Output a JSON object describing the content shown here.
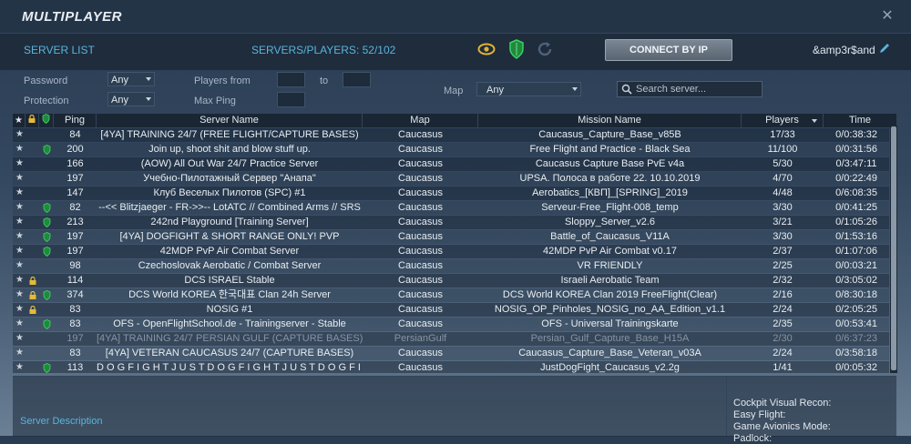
{
  "window": {
    "title": "MULTIPLAYER",
    "close_glyph": "✕"
  },
  "topbar": {
    "server_list_label": "SERVER LIST",
    "players_label": "SERVERS/PLAYERS: 52/102",
    "connect_label": "CONNECT BY IP",
    "nickname": "&amp3r$and",
    "icons": [
      "eye-icon",
      "shield-icon",
      "refresh-icon",
      "pencil-icon"
    ]
  },
  "filters": {
    "password_label": "Password",
    "password_value": "Any",
    "protection_label": "Protection",
    "protection_value": "Any",
    "players_from_label": "Players from",
    "to_label": "to",
    "max_ping_label": "Max Ping",
    "map_label": "Map",
    "map_value": "Any",
    "search_placeholder": "Search server..."
  },
  "table": {
    "headers": {
      "ping": "Ping",
      "name": "Server Name",
      "map": "Map",
      "mission": "Mission Name",
      "players": "Players",
      "time": "Time"
    },
    "rows": [
      {
        "lock": false,
        "shield": false,
        "ping": "84",
        "name": "[4YA] TRAINING 24/7 (FREE FLIGHT/CAPTURE BASES)",
        "map": "Caucasus",
        "mission": "Caucasus_Capture_Base_v85B",
        "players": "17/33",
        "time": "0/0:38:32",
        "dim": false
      },
      {
        "lock": false,
        "shield": true,
        "ping": "200",
        "name": "Join up, shoot shit and blow stuff up.",
        "map": "Caucasus",
        "mission": "Free Flight and Practice - Black Sea",
        "players": "11/100",
        "time": "0/0:31:56",
        "dim": false
      },
      {
        "lock": false,
        "shield": false,
        "ping": "166",
        "name": "(AOW) All Out War 24/7 Practice Server",
        "map": "Caucasus",
        "mission": "Caucasus Capture Base PvE v4a",
        "players": "5/30",
        "time": "0/3:47:11",
        "dim": false
      },
      {
        "lock": false,
        "shield": false,
        "ping": "197",
        "name": "Учебно-Пилотажный Сервер \"Анапа\"",
        "map": "Caucasus",
        "mission": "UPSA. Полоса в работе 22.  10.10.2019",
        "players": "4/70",
        "time": "0/0:22:49",
        "dim": false
      },
      {
        "lock": false,
        "shield": false,
        "ping": "147",
        "name": "Клуб Веселых Пилотов (SPC) #1",
        "map": "Caucasus",
        "mission": "Aerobatics_[КВП]_[SPRING]_2019",
        "players": "4/48",
        "time": "0/6:08:35",
        "dim": false
      },
      {
        "lock": false,
        "shield": true,
        "ping": "82",
        "name": "--<< Blitzjaeger - FR->>-- LotATC // Combined Arms // SRS",
        "map": "Caucasus",
        "mission": "Serveur-Free_Flight-008_temp",
        "players": "3/30",
        "time": "0/0:41:25",
        "dim": false
      },
      {
        "lock": false,
        "shield": true,
        "ping": "213",
        "name": "242nd Playground [Training Server]",
        "map": "Caucasus",
        "mission": "Sloppy_Server_v2.6",
        "players": "3/21",
        "time": "0/1:05:26",
        "dim": false
      },
      {
        "lock": false,
        "shield": true,
        "ping": "197",
        "name": "[4YA] DOGFIGHT & SHORT RANGE ONLY! PVP",
        "map": "Caucasus",
        "mission": "Battle_of_Caucasus_V11A",
        "players": "3/30",
        "time": "0/1:53:16",
        "dim": false
      },
      {
        "lock": false,
        "shield": true,
        "ping": "197",
        "name": "42MDP PvP Air Combat Server",
        "map": "Caucasus",
        "mission": "42MDP PvP Air Combat v0.17",
        "players": "2/37",
        "time": "0/1:07:06",
        "dim": false
      },
      {
        "lock": false,
        "shield": false,
        "ping": "98",
        "name": "Czechoslovak Aerobatic / Combat Server",
        "map": "Caucasus",
        "mission": "VR FRIENDLY",
        "players": "2/25",
        "time": "0/0:03:21",
        "dim": false
      },
      {
        "lock": true,
        "shield": false,
        "ping": "114",
        "name": "DCS ISRAEL Stable",
        "map": "Caucasus",
        "mission": "Israeli Aerobatic Team",
        "players": "2/32",
        "time": "0/3:05:02",
        "dim": false
      },
      {
        "lock": true,
        "shield": true,
        "ping": "374",
        "name": "DCS World KOREA 한국대표 Clan 24h Server",
        "map": "Caucasus",
        "mission": "DCS World KOREA Clan 2019 FreeFlight(Clear)",
        "players": "2/16",
        "time": "0/8:30:18",
        "dim": false
      },
      {
        "lock": true,
        "shield": false,
        "ping": "83",
        "name": "NOSIG #1",
        "map": "Caucasus",
        "mission": "NOSIG_OP_Pinholes_NOSIG_no_AA_Edition_v1.1",
        "players": "2/24",
        "time": "0/2:05:25",
        "dim": false
      },
      {
        "lock": false,
        "shield": true,
        "ping": "83",
        "name": "OFS - OpenFlightSchool.de - Trainingserver - Stable",
        "map": "Caucasus",
        "mission": "OFS - Universal Trainingskarte",
        "players": "2/35",
        "time": "0/0:53:41",
        "dim": false
      },
      {
        "lock": false,
        "shield": false,
        "ping": "197",
        "name": "[4YA] TRAINING 24/7 PERSIAN GULF (CAPTURE BASES)",
        "map": "PersianGulf",
        "mission": "Persian_Gulf_Capture_Base_H15A",
        "players": "2/30",
        "time": "0/6:37:23",
        "dim": true
      },
      {
        "lock": false,
        "shield": false,
        "ping": "83",
        "name": "[4YA] VETERAN CAUCASUS 24/7 (CAPTURE BASES)",
        "map": "Caucasus",
        "mission": "Caucasus_Capture_Base_Veteran_v03A",
        "players": "2/24",
        "time": "0/3:58:18",
        "dim": false
      },
      {
        "lock": false,
        "shield": true,
        "ping": "113",
        "name": "D O G F I G H T   J U S T   D O G F I G H T   J U S T   D O G F I C",
        "map": "Caucasus",
        "mission": "JustDogFight_Caucasus_v2.2g",
        "players": "1/41",
        "time": "0/0:05:32",
        "dim": false
      }
    ]
  },
  "bottom": {
    "server_description_label": "Server Description",
    "side_labels": [
      "Cockpit Visual Recon:",
      "Easy Flight:",
      "Game Avionics Mode:",
      "Padlock:"
    ]
  }
}
